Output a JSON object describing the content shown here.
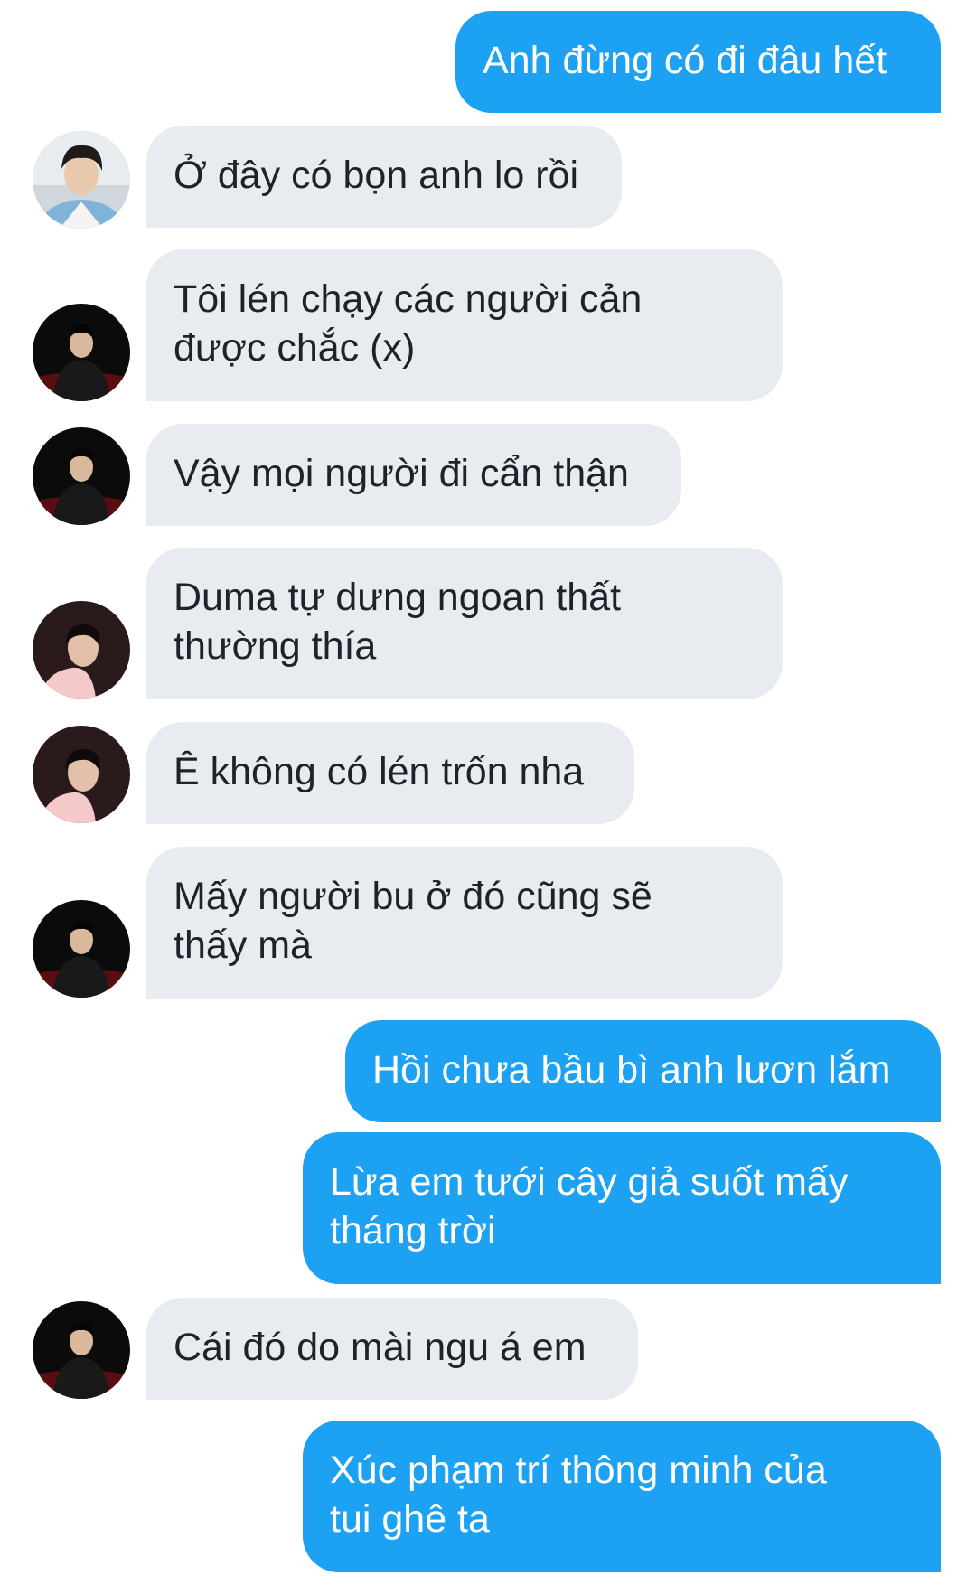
{
  "colors": {
    "sent_bubble": "#1da1f2",
    "received_bubble": "#e8ecf1",
    "sent_text": "#ffffff",
    "received_text": "#1e2329",
    "background": "#ffffff"
  },
  "messages": [
    {
      "sender": "me",
      "text": "Anh đừng có đi đâu hết"
    },
    {
      "sender": "friend-blue-shirt",
      "avatar": "avatar-blue-shirt",
      "text": "Ở đây có bọn anh lo rồi"
    },
    {
      "sender": "friend-black-jacket",
      "avatar": "avatar-black-jacket",
      "text": "Tôi lén chạy các người cản\nđược chắc (x)"
    },
    {
      "sender": "friend-black-jacket",
      "avatar": "avatar-black-jacket",
      "text": "Vậy mọi người đi cẩn thận"
    },
    {
      "sender": "friend-pink-shirt",
      "avatar": "avatar-pink-shirt",
      "text": "Duma tự dưng ngoan thất\nthường thía"
    },
    {
      "sender": "friend-pink-shirt",
      "avatar": "avatar-pink-shirt",
      "text": "Ê không có lén trốn nha"
    },
    {
      "sender": "friend-black-jacket",
      "avatar": "avatar-black-jacket",
      "text": "Mấy người bu ở đó cũng sẽ\nthấy mà"
    },
    {
      "sender": "me",
      "text": "Hồi chưa bầu bì anh lươn lắm"
    },
    {
      "sender": "me",
      "text": "Lừa em tưới cây giả suốt mấy\ntháng trời"
    },
    {
      "sender": "friend-black-jacket",
      "avatar": "avatar-black-jacket",
      "text": "Cái đó do mài ngu á em"
    },
    {
      "sender": "me",
      "text": "Xúc phạm trí thông minh của\ntui ghê ta"
    }
  ]
}
